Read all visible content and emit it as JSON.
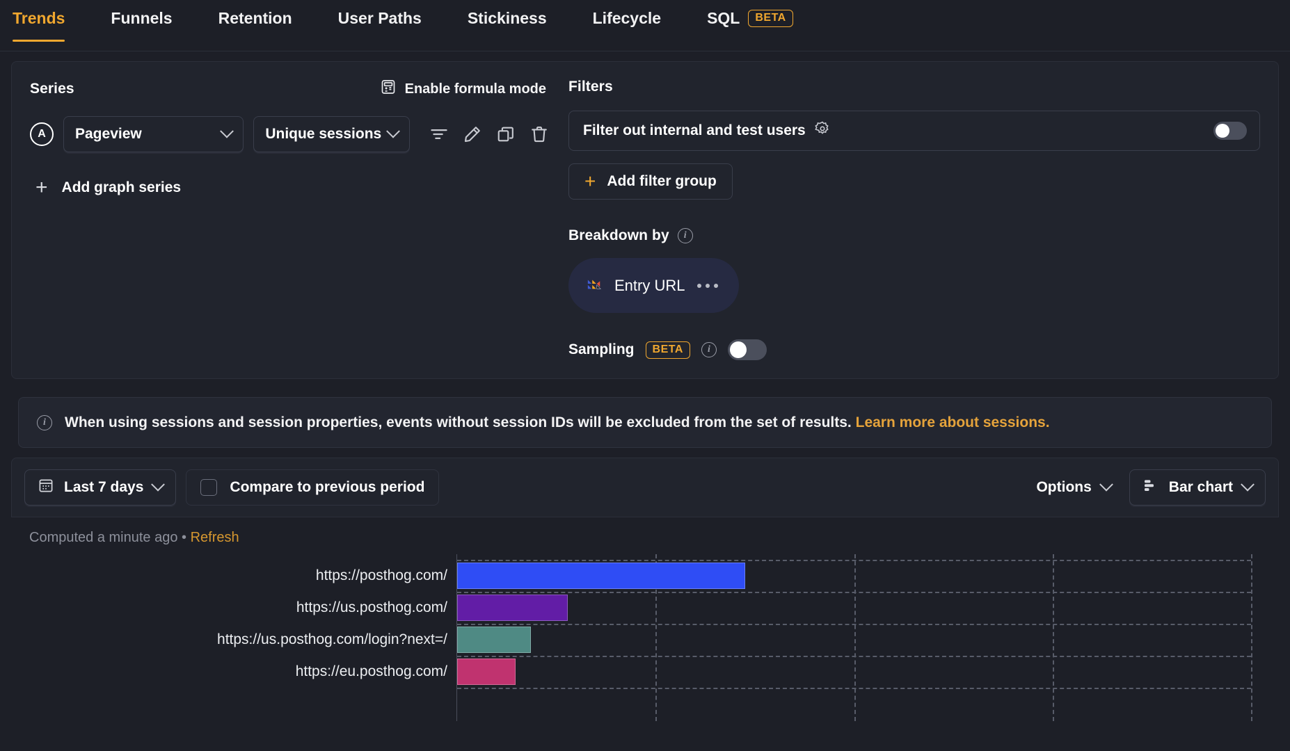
{
  "tabs": [
    {
      "label": "Trends",
      "active": true
    },
    {
      "label": "Funnels",
      "active": false
    },
    {
      "label": "Retention",
      "active": false
    },
    {
      "label": "User Paths",
      "active": false
    },
    {
      "label": "Stickiness",
      "active": false
    },
    {
      "label": "Lifecycle",
      "active": false
    },
    {
      "label": "SQL",
      "active": false,
      "badge": "BETA"
    }
  ],
  "series": {
    "title": "Series",
    "formula_mode_label": "Enable formula mode",
    "formula_icon": "calculator-icon",
    "badge_letter": "A",
    "event": "Pageview",
    "math": "Unique sessions",
    "actions": [
      "filter-icon",
      "edit-pencil-icon",
      "duplicate-icon",
      "trash-icon"
    ],
    "add_series_label": "Add graph series"
  },
  "filters": {
    "title": "Filters",
    "internal_users_label": "Filter out internal and test users",
    "internal_users_gear": "gear-icon",
    "internal_users_enabled": false,
    "add_filter_group_label": "Add filter group"
  },
  "breakdown": {
    "title": "Breakdown by",
    "info_icon": "info-icon",
    "property": "Entry URL",
    "property_icon": "posthog-session-icon",
    "more_icon": "ellipsis-icon"
  },
  "sampling": {
    "label": "Sampling",
    "badge": "BETA",
    "info_icon": "info-icon",
    "enabled": false
  },
  "banner": {
    "icon": "info-icon",
    "text": "When using sessions and session properties, events without session IDs will be excluded from the set of results.",
    "link_text": "Learn more about sessions."
  },
  "toolbar": {
    "date_range": "Last 7 days",
    "date_icon": "calendar-icon",
    "compare_label": "Compare to previous period",
    "compare_checked": false,
    "options_label": "Options",
    "chart_type": "Bar chart",
    "chart_type_icon": "bar-chart-icon"
  },
  "status": {
    "computed_text": "Computed a minute ago",
    "separator": "•",
    "refresh_label": "Refresh"
  },
  "colors": {
    "accent": "#f0a72f",
    "background": "#1d1f27",
    "card": "#21242d",
    "border": "#2c2f3a",
    "pill_background": "#262a42"
  },
  "chart_data": {
    "type": "bar",
    "orientation": "horizontal",
    "title": "",
    "xlabel": "",
    "ylabel": "",
    "grid": true,
    "legend": "none",
    "categories": [
      "https://posthog.com/",
      "https://us.posthog.com/",
      "https://us.posthog.com/login?next=/",
      "https://eu.posthog.com/"
    ],
    "values": [
      203,
      78,
      52,
      41
    ],
    "xlim": [
      0,
      560
    ],
    "xticks": [
      0,
      140,
      280,
      420,
      560
    ],
    "bar_colors": [
      "#2f4df5",
      "#621da6",
      "#4f8a84",
      "#c0336f"
    ]
  }
}
